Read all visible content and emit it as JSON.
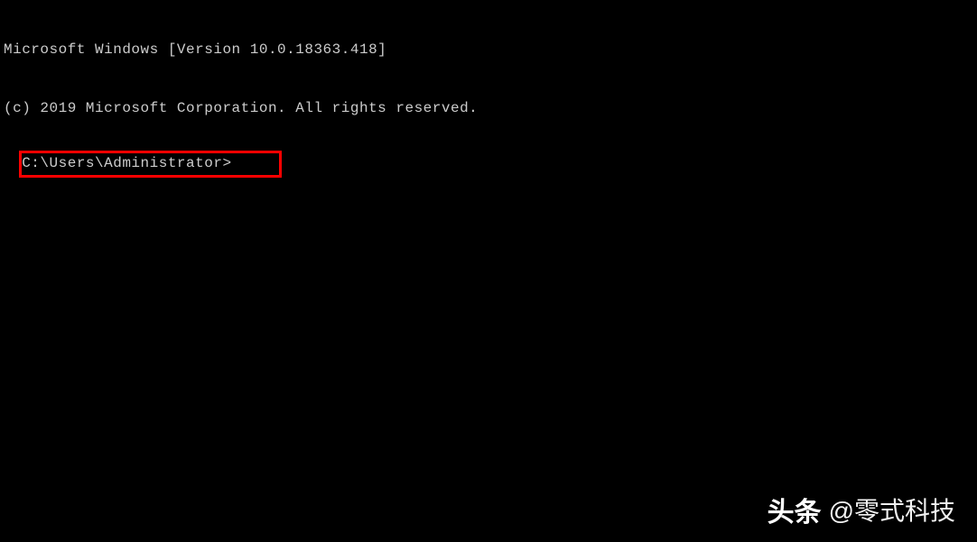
{
  "terminal": {
    "line1": "Microsoft Windows [Version 10.0.18363.418]",
    "line2": "(c) 2019 Microsoft Corporation. All rights reserved.",
    "prompt": "C:\\Users\\Administrator>"
  },
  "watermark": {
    "brand": "头条",
    "handle": "@零式科技"
  },
  "colors": {
    "background": "#000000",
    "text": "#cccccc",
    "highlight_border": "#ff0000",
    "watermark_text": "#ffffff"
  }
}
